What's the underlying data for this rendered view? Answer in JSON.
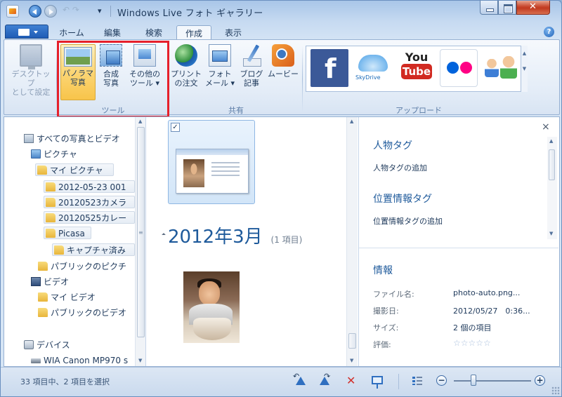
{
  "window": {
    "title": "Windows Live フォト ギャラリー"
  },
  "tabs": [
    {
      "label": "ホーム",
      "active": false
    },
    {
      "label": "編集",
      "active": false
    },
    {
      "label": "検索",
      "active": false
    },
    {
      "label": "作成",
      "active": true
    },
    {
      "label": "表示",
      "active": false
    }
  ],
  "ribbon": {
    "desktop": {
      "label1": "デスクトップ",
      "label2": "として設定"
    },
    "tools": {
      "panorama": {
        "label1": "パノラマ",
        "label2": "写真"
      },
      "composite": {
        "label1": "合成",
        "label2": "写真"
      },
      "other": {
        "label1": "その他の",
        "label2": "ツール ▾"
      },
      "group_label": "ツール"
    },
    "share": {
      "print": {
        "label1": "プリント",
        "label2": "の注文"
      },
      "mail": {
        "label1": "フォト",
        "label2": "メール ▾"
      },
      "blog": {
        "label1": "ブログ",
        "label2": "記事"
      },
      "movie": {
        "label1": "ムービー",
        "label2": ""
      },
      "group_label": "共有"
    },
    "upload": {
      "facebook": "f",
      "skydrive": "SkyDrive",
      "youtube_you": "You",
      "youtube_tube": "Tube",
      "group_label": "アップロード"
    }
  },
  "nav": {
    "items": [
      {
        "label": "すべての写真とビデオ",
        "icon": "photos-icon"
      },
      {
        "label": "ピクチャ",
        "icon": "pictures-icon"
      },
      {
        "label": "マイ ピクチャ",
        "icon": "folder-icon"
      },
      {
        "label": "2012-05-23 001",
        "icon": "folder-icon"
      },
      {
        "label": "20120523カメラ",
        "icon": "folder-icon"
      },
      {
        "label": "20120525カレー",
        "icon": "folder-icon"
      },
      {
        "label": "Picasa",
        "icon": "folder-icon"
      },
      {
        "label": "キャプチャ済み",
        "icon": "folder-icon"
      },
      {
        "label": "パブリックのピクチ",
        "icon": "folder-icon"
      },
      {
        "label": "ビデオ",
        "icon": "video-icon"
      },
      {
        "label": "マイ ビデオ",
        "icon": "folder-icon"
      },
      {
        "label": "パブリックのビデオ",
        "icon": "folder-icon"
      },
      {
        "label": "デバイス",
        "icon": "device-icon"
      },
      {
        "label": "WIA Canon MP970 s",
        "icon": "scanner-icon"
      }
    ]
  },
  "main": {
    "group_title": "2012年3月",
    "group_count": "(1 項目)",
    "check_mark": "✓"
  },
  "info": {
    "people_tag_heading": "人物タグ",
    "people_tag_add": "人物タグの追加",
    "geotag_heading": "位置情報タグ",
    "geotag_add": "位置情報タグの追加",
    "info_heading": "情報",
    "fields": [
      {
        "key": "ファイル名:",
        "value": "photo-auto.png..."
      },
      {
        "key": "撮影日:",
        "value": "2012/05/27　0:36..."
      },
      {
        "key": "サイズ:",
        "value": "2 個の項目"
      },
      {
        "key": "評価:",
        "value": "☆☆☆☆☆"
      }
    ],
    "close": "×"
  },
  "status": {
    "text": "33 項目中、2 項目を選択",
    "zoom_level": 0.25
  },
  "help": "?"
}
